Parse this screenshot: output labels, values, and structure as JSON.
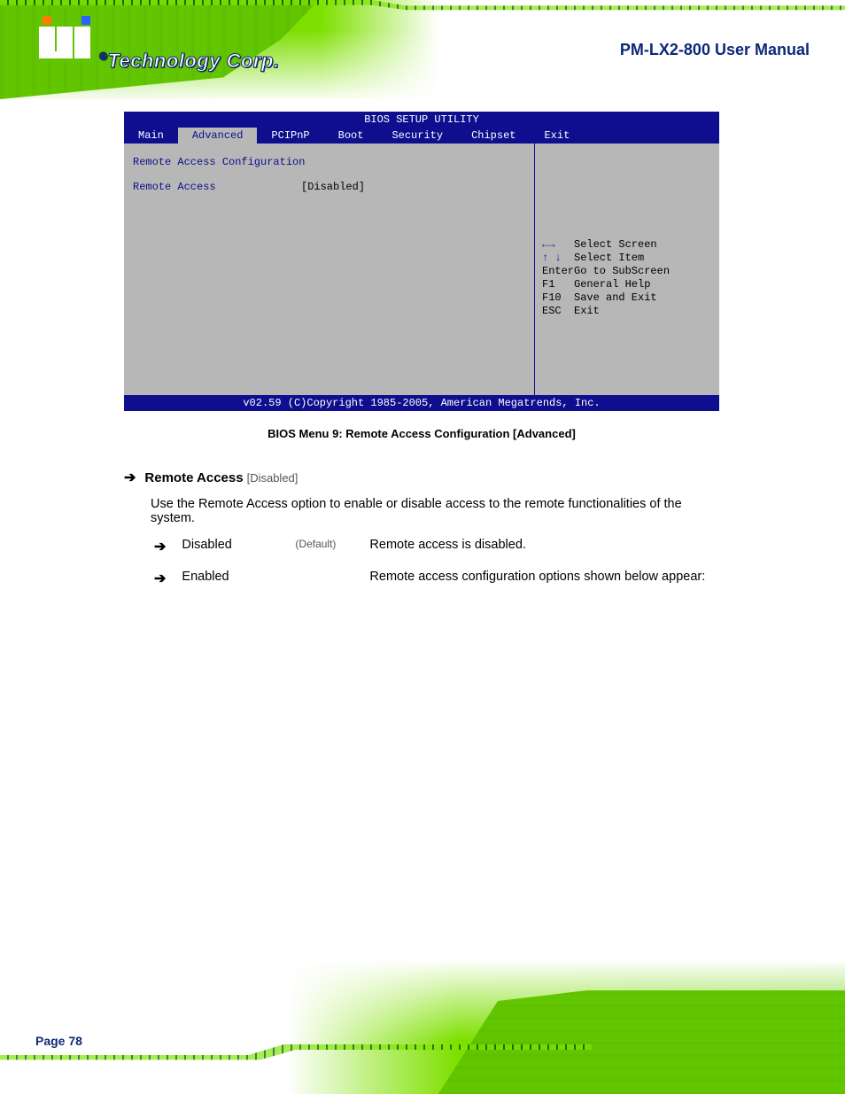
{
  "header": {
    "brand_registered": "®",
    "brand_text": "Technology Corp.",
    "doc_title": "PM-LX2-800 User Manual"
  },
  "bios": {
    "title": "BIOS SETUP UTILITY",
    "tabs": [
      "Main",
      "Advanced",
      "PCIPnP",
      "Boot",
      "Security",
      "Chipset",
      "Exit"
    ],
    "active_tab_index": 1,
    "panel_header": "Remote Access Configuration",
    "rows": [
      {
        "label": "Remote Access",
        "value": "[Disabled]"
      }
    ],
    "right": {
      "hint": "",
      "keys": [
        {
          "sym": "←→",
          "txt": "Select Screen"
        },
        {
          "sym": "↑ ↓",
          "txt": "Select Item"
        },
        {
          "sym": "Enter",
          "txt": "Go to SubScreen"
        },
        {
          "sym": "F1",
          "txt": "General Help"
        },
        {
          "sym": "F10",
          "txt": "Save and Exit"
        },
        {
          "sym": "ESC",
          "txt": "Exit"
        }
      ]
    },
    "version_line": "v02.59 (C)Copyright 1985-2005, American Megatrends, Inc."
  },
  "caption": "BIOS Menu 9: Remote Access Configuration [Advanced]",
  "option": {
    "heading_title": "Remote Access",
    "heading_meta": "[Disabled]",
    "description": "Use the Remote Access option to enable or disable access to the remote functionalities of the system.",
    "items": [
      {
        "label": "Disabled",
        "default": "(Default)",
        "text": "Remote access is disabled."
      },
      {
        "label": "Enabled",
        "default": "",
        "text": "Remote access configuration options shown below appear:"
      }
    ]
  },
  "footer": {
    "page_number": "Page 78"
  }
}
